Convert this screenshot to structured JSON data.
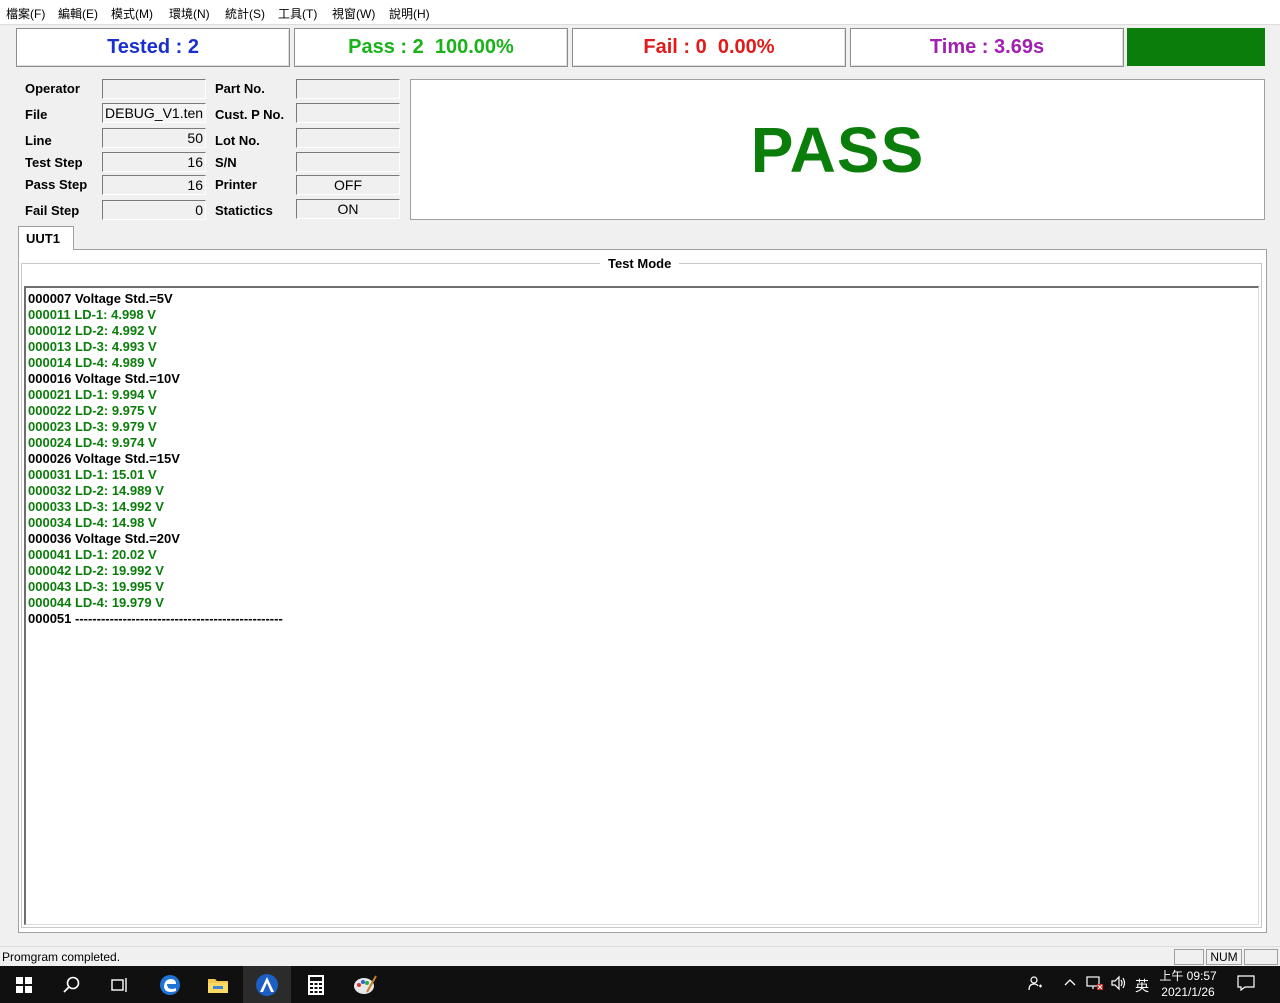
{
  "menu": [
    "檔案(F)",
    "編輯(E)",
    "模式(M)",
    "環境(N)",
    "統計(S)",
    "工具(T)",
    "視窗(W)",
    "說明(H)"
  ],
  "summary": {
    "tested": "Tested : 2",
    "pass": "Pass : 2  100.00%",
    "fail": "Fail : 0  0.00%",
    "time": "Time : 3.69s"
  },
  "colors": {
    "tested": "#1a2fd0",
    "pass": "#19b319",
    "fail": "#e01b1b",
    "time": "#a020b0",
    "pass_banner": "#0a7d0a",
    "log_header": "#000000",
    "log_value": "#0a7d0a"
  },
  "info": {
    "operator_label": "Operator",
    "operator_value": "",
    "file_label": "File",
    "file_value": "DEBUG_V1.ten",
    "line_label": "Line",
    "line_value": "50",
    "teststep_label": "Test Step",
    "teststep_value": "16",
    "passstep_label": "Pass Step",
    "passstep_value": "16",
    "failstep_label": "Fail Step",
    "failstep_value": "0",
    "partno_label": "Part No.",
    "partno_value": "",
    "custpno_label": "Cust. P No.",
    "custpno_value": "",
    "lotno_label": "Lot No.",
    "lotno_value": "",
    "sn_label": "S/N",
    "sn_value": "",
    "printer_label": "Printer",
    "printer_value": "OFF",
    "statictics_label": "Statictics",
    "statictics_value": "ON"
  },
  "result_text": "PASS",
  "tab_label": "UUT1",
  "group_title": "Test Mode",
  "log": [
    {
      "text": "000007 Voltage Std.=5V",
      "kind": "header"
    },
    {
      "text": "000011 LD-1: 4.998 V",
      "kind": "value"
    },
    {
      "text": "000012 LD-2: 4.992 V",
      "kind": "value"
    },
    {
      "text": "000013 LD-3: 4.993 V",
      "kind": "value"
    },
    {
      "text": "000014 LD-4: 4.989 V",
      "kind": "value"
    },
    {
      "text": "000016 Voltage Std.=10V",
      "kind": "header"
    },
    {
      "text": "000021 LD-1: 9.994 V",
      "kind": "value"
    },
    {
      "text": "000022 LD-2: 9.975 V",
      "kind": "value"
    },
    {
      "text": "000023 LD-3: 9.979 V",
      "kind": "value"
    },
    {
      "text": "000024 LD-4: 9.974 V",
      "kind": "value"
    },
    {
      "text": "000026 Voltage Std.=15V",
      "kind": "header"
    },
    {
      "text": "000031 LD-1: 15.01 V",
      "kind": "value"
    },
    {
      "text": "000032 LD-2: 14.989 V",
      "kind": "value"
    },
    {
      "text": "000033 LD-3: 14.992 V",
      "kind": "value"
    },
    {
      "text": "000034 LD-4: 14.98 V",
      "kind": "value"
    },
    {
      "text": "000036 Voltage Std.=20V",
      "kind": "header"
    },
    {
      "text": "000041 LD-1: 20.02 V",
      "kind": "value"
    },
    {
      "text": "000042 LD-2: 19.992 V",
      "kind": "value"
    },
    {
      "text": "000043 LD-3: 19.995 V",
      "kind": "value"
    },
    {
      "text": "000044 LD-4: 19.979 V",
      "kind": "value"
    },
    {
      "text": "000051 ------------------------------------------------",
      "kind": "header"
    }
  ],
  "status": {
    "message": "Promgram completed.",
    "num": "NUM"
  },
  "taskbar": {
    "icons": [
      "windows-start-icon",
      "search-icon",
      "task-view-icon",
      "edge-browser-icon",
      "file-explorer-icon",
      "test-app-icon",
      "calculator-icon",
      "paint-icon"
    ],
    "ime": "英",
    "time": "上午 09:57",
    "date": "2021/1/26"
  }
}
